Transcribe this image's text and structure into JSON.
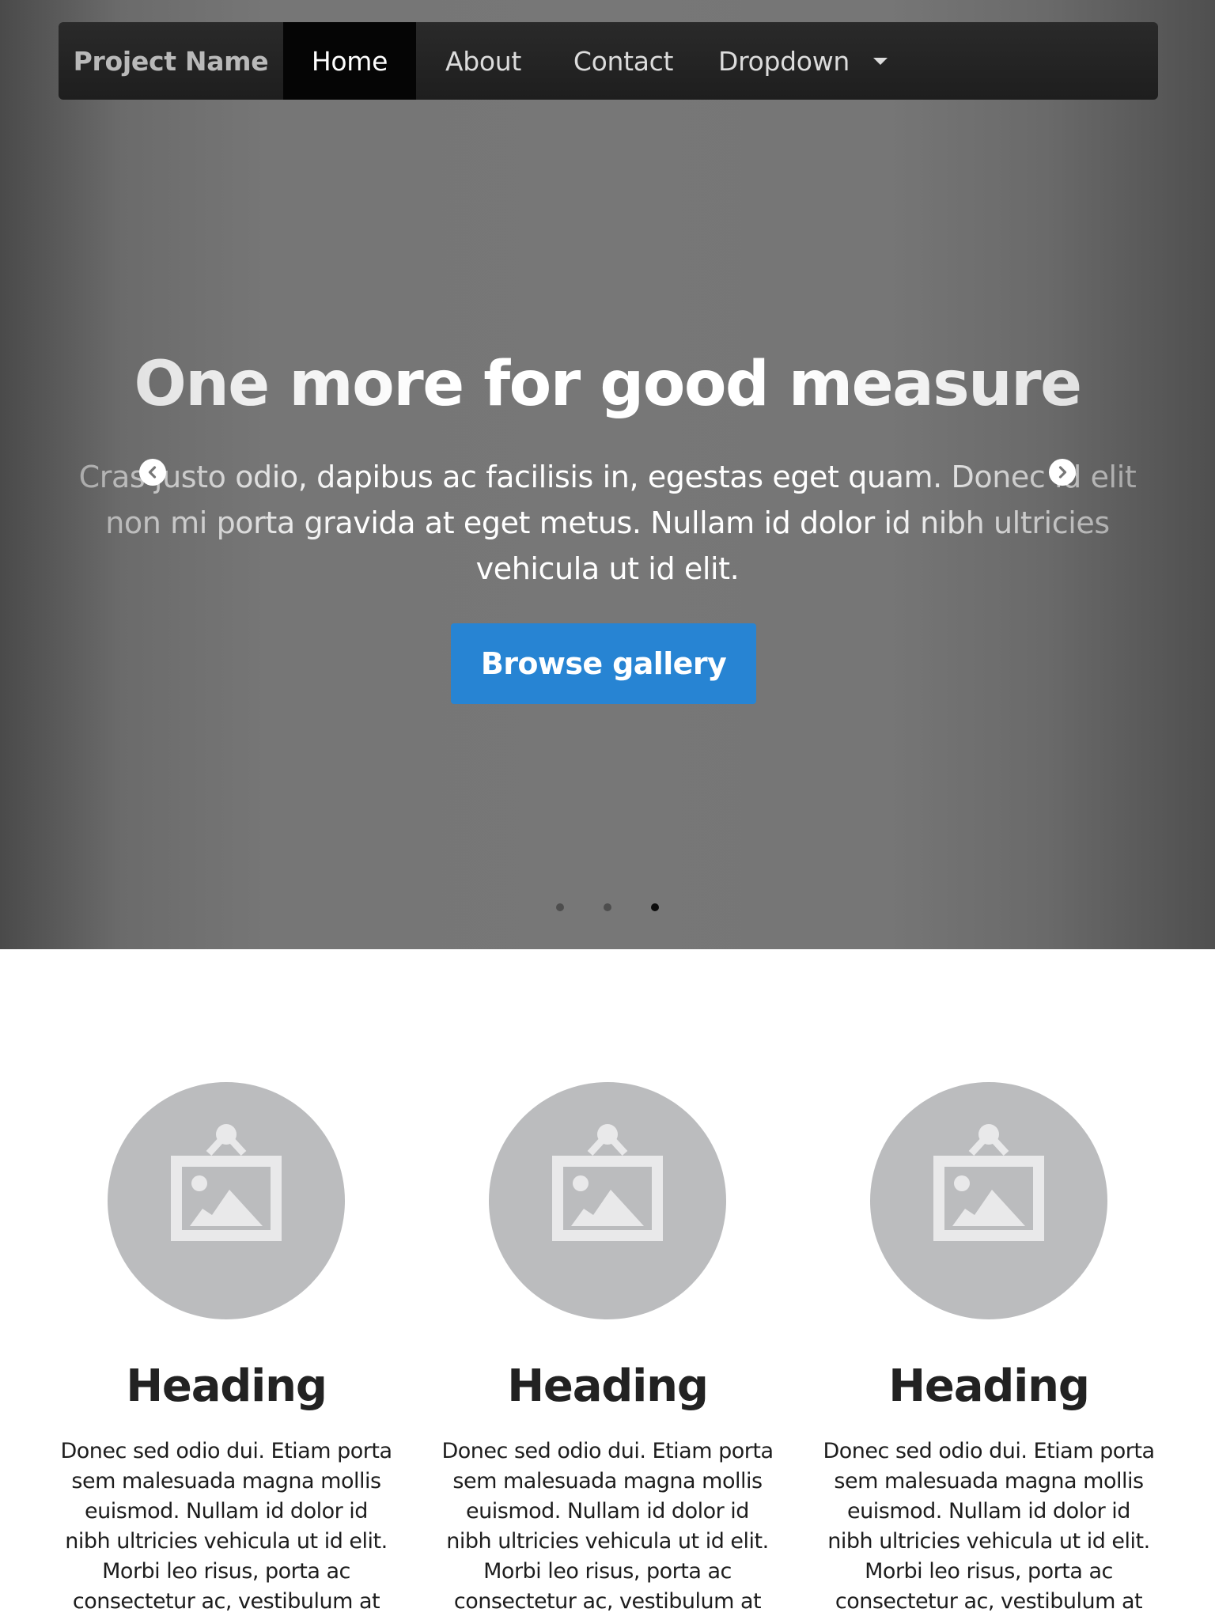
{
  "navbar": {
    "brand": "Project Name",
    "items": [
      {
        "label": "Home",
        "active": true
      },
      {
        "label": "About",
        "active": false
      },
      {
        "label": "Contact",
        "active": false
      },
      {
        "label": "Dropdown",
        "active": false
      }
    ]
  },
  "carousel": {
    "title": "One more for good measure",
    "text": "Cras justo odio, dapibus ac facilisis in, egestas eget quam. Donec id elit non mi porta gravida at eget metus. Nullam id dolor id nibh ultricies vehicula ut id elit.",
    "button": "Browse gallery",
    "slide_count": 3,
    "active_slide": 3,
    "controls": {
      "prev_icon": "chevron-left-circle-icon",
      "next_icon": "chevron-right-circle-icon"
    }
  },
  "marketing": {
    "columns": [
      {
        "heading": "Heading",
        "text": "Donec sed odio dui. Etiam porta sem malesuada magna mollis euismod. Nullam id dolor id nibh ultricies vehicula ut id elit. Morbi leo risus, porta ac consectetur ac, vestibulum at eros. Praesent",
        "image_icon": "image-placeholder-icon"
      },
      {
        "heading": "Heading",
        "text": "Donec sed odio dui. Etiam porta sem malesuada magna mollis euismod. Nullam id dolor id nibh ultricies vehicula ut id elit. Morbi leo risus, porta ac consectetur ac, vestibulum at eros. Praesent",
        "image_icon": "image-placeholder-icon"
      },
      {
        "heading": "Heading",
        "text": "Donec sed odio dui. Etiam porta sem malesuada magna mollis euismod. Nullam id dolor id nibh ultricies vehicula ut id elit. Morbi leo risus, porta ac consectetur ac, vestibulum at eros. Praesent",
        "image_icon": "image-placeholder-icon"
      }
    ]
  },
  "colors": {
    "navbar_bg": "#222222",
    "active_nav_bg": "#050505",
    "button_primary": "#2784d3",
    "placeholder_circle": "#bbbcbe",
    "placeholder_icon": "#e9e9ea",
    "hero_bg": "#777777"
  }
}
